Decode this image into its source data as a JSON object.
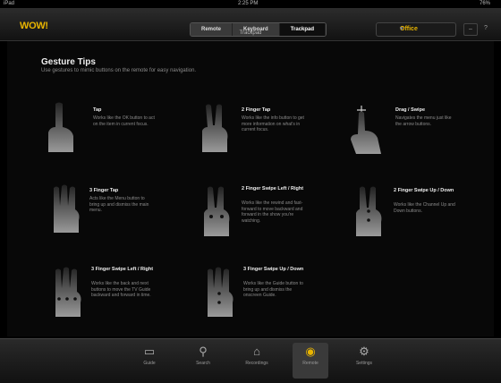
{
  "status": {
    "device": "iPad",
    "time": "2:25 PM",
    "battery": "76%"
  },
  "header": {
    "logo": "WOW!",
    "segments": [
      "Remote",
      "Keyboard",
      "Trackpad"
    ],
    "active_segment": 2,
    "subtitle": "Trackpad",
    "location": "Office"
  },
  "main": {
    "title": "Gesture Tips",
    "description": "Use gestures to mimic buttons on the remote for easy navigation.",
    "tips": [
      {
        "name": "Tap",
        "desc": "Works like the OK button to act on the item in current focus."
      },
      {
        "name": "2 Finger Tap",
        "desc": "Works like the info button to get more information on what's in current focus."
      },
      {
        "name": "Drag / Swipe",
        "desc": "Navigates the menu just like the arrow buttons."
      },
      {
        "name": "3 Finger Tap",
        "desc": "Acts like the Menu button to bring up and dismiss the main menu."
      },
      {
        "name": "2 Finger Swipe Left / Right",
        "desc": "Works like the rewind and fast-forward to move backward and forward in the show you're watching."
      },
      {
        "name": "2 Finger Swipe Up / Down",
        "desc": "Works like the Channel Up and Down buttons."
      },
      {
        "name": "3 Finger Swipe Left / Right",
        "desc": "Works like the back and next buttons to move the TV Guide backward and forward in time."
      },
      {
        "name": "3 Finger Swipe Up / Down",
        "desc": "Works like the Guide button to bring up and dismiss the onscreen Guide."
      }
    ]
  },
  "tabbar": {
    "items": [
      {
        "label": "Guide",
        "icon": "tv-icon"
      },
      {
        "label": "Search",
        "icon": "search-icon"
      },
      {
        "label": "Recordings",
        "icon": "recordings-icon"
      },
      {
        "label": "Remote",
        "icon": "remote-icon"
      },
      {
        "label": "Settings",
        "icon": "settings-icon"
      }
    ],
    "active": 3
  }
}
